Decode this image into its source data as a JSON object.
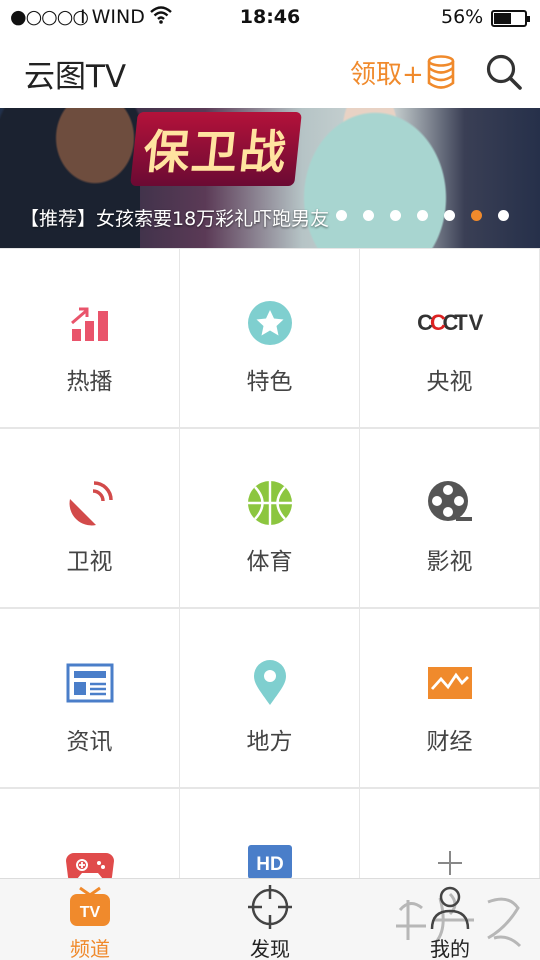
{
  "status_bar": {
    "signal": "●○○○○",
    "carrier": "I WIND",
    "time": "18:46",
    "battery_percent": "56%"
  },
  "header": {
    "title": "云图TV",
    "claim_label": "领取+",
    "claim_icon": "coin-stack-icon",
    "search_icon": "search-icon"
  },
  "banner": {
    "show_title": "保卫战",
    "caption": "【推荐】女孩索要18万彩礼吓跑男友",
    "dot_count": 7,
    "active_dot_index": 5
  },
  "categories": [
    {
      "label": "热播",
      "icon": "trending-bars-icon"
    },
    {
      "label": "特色",
      "icon": "star-icon"
    },
    {
      "label": "央视",
      "icon": "cctv-logo-icon"
    },
    {
      "label": "卫视",
      "icon": "satellite-dish-icon"
    },
    {
      "label": "体育",
      "icon": "basketball-icon"
    },
    {
      "label": "影视",
      "icon": "film-reel-icon"
    },
    {
      "label": "资讯",
      "icon": "newspaper-icon"
    },
    {
      "label": "地方",
      "icon": "location-pin-icon"
    },
    {
      "label": "财经",
      "icon": "stock-chart-icon"
    },
    {
      "label": "",
      "icon": "gamepad-icon"
    },
    {
      "label": "",
      "icon": "hd-icon"
    },
    {
      "label": "",
      "icon": "plus-icon"
    }
  ],
  "tabbar": {
    "tabs": [
      {
        "label": "频道",
        "icon": "tv-icon",
        "active": true
      },
      {
        "label": "发现",
        "icon": "crosshair-icon",
        "active": false
      },
      {
        "label": "我的",
        "icon": "user-icon",
        "active": false
      }
    ]
  },
  "colors": {
    "accent": "#f08a2c",
    "trending": "#e9546b",
    "star": "#7fcfcf",
    "satellite": "#d24a4a",
    "basketball": "#8cc63f",
    "film": "#555555",
    "news": "#4a7ec9",
    "pin": "#7fcfcf",
    "finance": "#f08a2c",
    "game": "#e04b4b",
    "hd": "#4a7ec9"
  }
}
